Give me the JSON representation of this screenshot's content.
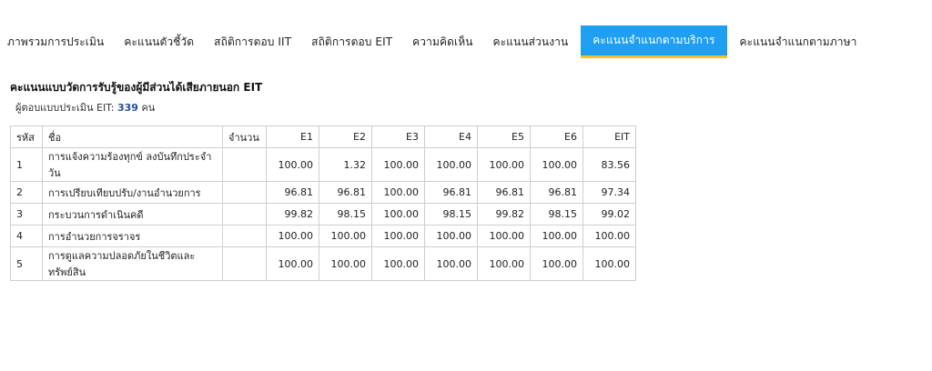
{
  "tabs": [
    {
      "label": "ภาพรวมการประเมิน",
      "active": false
    },
    {
      "label": "คะแนนตัวชี้วัด",
      "active": false
    },
    {
      "label": "สถิติการตอบ IIT",
      "active": false
    },
    {
      "label": "สถิติการตอบ EIT",
      "active": false
    },
    {
      "label": "ความคิดเห็น",
      "active": false
    },
    {
      "label": "คะแนนส่วนงาน",
      "active": false
    },
    {
      "label": "คะแนนจำแนกตามบริการ",
      "active": true
    },
    {
      "label": "คะแนนจำแนกตามภาษา",
      "active": false
    }
  ],
  "section": {
    "title": "คะแนนแบบวัดการรับรู้ของผู้มีส่วนได้เสียภายนอก EIT",
    "respondents_label": "ผู้ตอบแบบประเมิน EIT:",
    "respondents_count": "339",
    "respondents_unit": "คน"
  },
  "table": {
    "headers": [
      "รหัส",
      "ชื่อ",
      "จำนวน",
      "E1",
      "E2",
      "E3",
      "E4",
      "E5",
      "E6",
      "EIT"
    ],
    "rows": [
      {
        "code": "1",
        "name": "การแจ้งความร้องทุกข์ ลงบันทึกประจำวัน",
        "qty": "",
        "values": [
          "100.00",
          "1.32",
          "100.00",
          "100.00",
          "100.00",
          "100.00",
          "83.56"
        ]
      },
      {
        "code": "2",
        "name": "การเปรียบเทียบปรับ/งานอำนวยการ",
        "qty": "",
        "values": [
          "96.81",
          "96.81",
          "100.00",
          "96.81",
          "96.81",
          "96.81",
          "97.34"
        ]
      },
      {
        "code": "3",
        "name": "กระบวนการดำเนินคดี",
        "qty": "",
        "values": [
          "99.82",
          "98.15",
          "100.00",
          "98.15",
          "99.82",
          "98.15",
          "99.02"
        ]
      },
      {
        "code": "4",
        "name": "การอำนวยการจราจร",
        "qty": "",
        "values": [
          "100.00",
          "100.00",
          "100.00",
          "100.00",
          "100.00",
          "100.00",
          "100.00"
        ]
      },
      {
        "code": "5",
        "name": "การดูแลความปลอดภัยในชีวิตและทรัพย์สิน",
        "qty": "",
        "values": [
          "100.00",
          "100.00",
          "100.00",
          "100.00",
          "100.00",
          "100.00",
          "100.00"
        ]
      }
    ]
  },
  "colors": {
    "active_tab": "#1e9ff2",
    "active_tab_underline": "#f2c12e",
    "count_text": "#1f4e99",
    "border": "#cfcfcf"
  }
}
